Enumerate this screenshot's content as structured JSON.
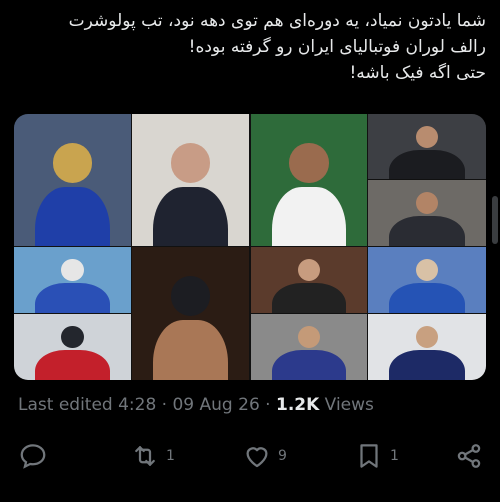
{
  "tweet": {
    "lines": [
      "شما یادتون نمیاد، یه دوره‌ای هم توی دهه نود، تب پولوشرت",
      "رالف لوران فوتبالیای ایران رو گرفته بوده!",
      "حتی اگه فیک باشه!"
    ]
  },
  "media": {
    "tiles": [
      {
        "name": "tile-top-left",
        "colors": [
          "#4a5b78",
          "#1f3fa8",
          "#c9a44f"
        ]
      },
      {
        "name": "tile-top-center",
        "colors": [
          "#d9d6d0",
          "#1f2330",
          "#c89c86"
        ]
      },
      {
        "name": "tile-top-right-main",
        "colors": [
          "#2e6b3a",
          "#f2f2f2",
          "#9a6b4e"
        ]
      },
      {
        "name": "tile-top-right-small-1",
        "colors": [
          "#3d3f44",
          "#1b1c20",
          "#b88c6f"
        ]
      },
      {
        "name": "tile-top-right-small-2",
        "colors": [
          "#6d6a66",
          "#2a2c33",
          "#b28466"
        ]
      },
      {
        "name": "tile-mid-left",
        "colors": [
          "#6aa0cc",
          "#2a50b6",
          "#e6e6e6"
        ]
      },
      {
        "name": "tile-bottom-left",
        "colors": [
          "#cfd3d8",
          "#c3202b",
          "#23262d"
        ]
      },
      {
        "name": "tile-selfie",
        "colors": [
          "#2b1c14",
          "#a97756",
          "#1c1d22"
        ]
      },
      {
        "name": "tile-mid-right-1",
        "colors": [
          "#5b3b2c",
          "#222",
          "#c79c7f"
        ]
      },
      {
        "name": "tile-mid-right-2",
        "colors": [
          "#5a7fbf",
          "#2553b5",
          "#d8c1a6"
        ]
      },
      {
        "name": "tile-bottom-right-1",
        "colors": [
          "#8a8a8a",
          "#2c3a8c",
          "#c49a78"
        ]
      },
      {
        "name": "tile-bottom-right-2",
        "colors": [
          "#e1e3e6",
          "#1d2a66",
          "#c8a080"
        ]
      }
    ]
  },
  "meta": {
    "edited_label": "Last edited 4:28 · 09 Aug 26 · ",
    "views_count": "1.2K",
    "views_label": " Views"
  },
  "actions": {
    "replies_icon": "reply-icon",
    "retweets_icon": "retweet-icon",
    "retweets_count": "1",
    "likes_icon": "heart-icon",
    "likes_count": "9",
    "bookmarks_icon": "bookmark-icon",
    "bookmarks_count": "1",
    "share_icon": "share-icon",
    "icon_color": "#71767b"
  }
}
